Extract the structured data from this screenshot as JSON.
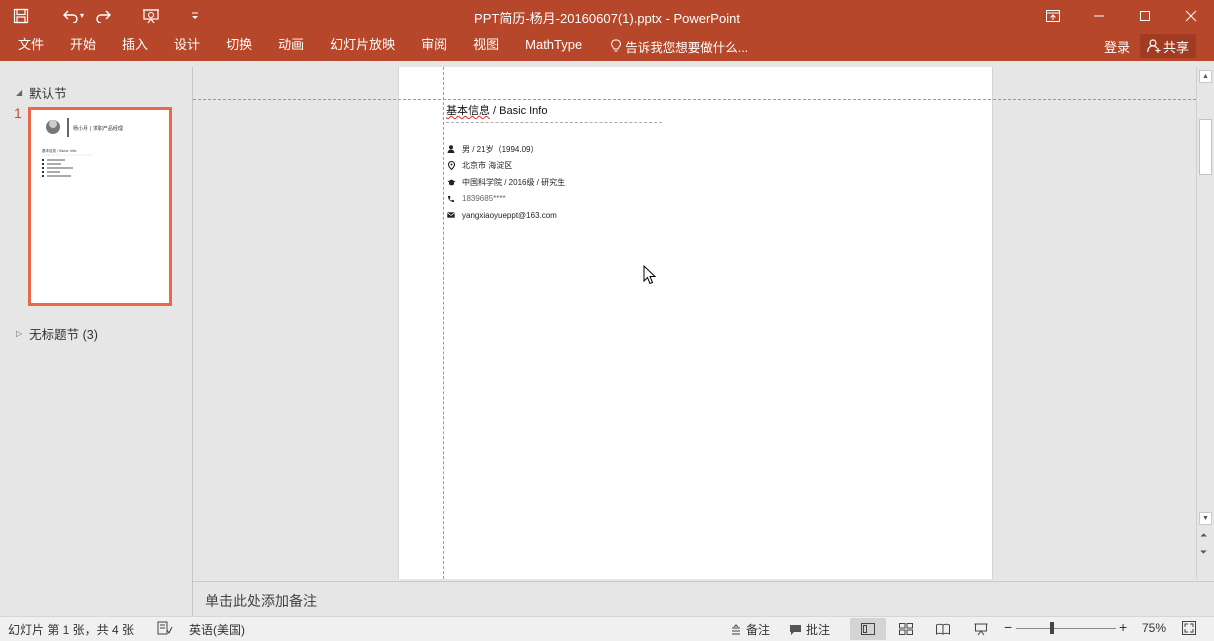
{
  "window": {
    "title": "PPT简历-杨月-20160607(1).pptx - PowerPoint"
  },
  "qat": {
    "icons": [
      "save-icon",
      "undo-icon",
      "redo-icon",
      "present-from-start-icon",
      "customize-qat-icon"
    ]
  },
  "ribbon": {
    "tabs": [
      "文件",
      "开始",
      "插入",
      "设计",
      "切换",
      "动画",
      "幻灯片放映",
      "审阅",
      "视图",
      "MathType"
    ],
    "tell_me": "告诉我您想要做什么...",
    "login": "登录",
    "share": "共享"
  },
  "thumbnails": {
    "section_default": "默认节",
    "section_untitled": "无标题节 (3)",
    "slide_number": "1",
    "thumb_title": "杨小月 | 求职产品经理",
    "thumb_subtitle": "基本信息 / Basic Info"
  },
  "slide": {
    "heading_cn": "基本信息",
    "heading_rest": " / Basic Info",
    "info": [
      {
        "icon": "person-icon",
        "text": "男 / 21岁（1994.09）"
      },
      {
        "icon": "location-pin-icon",
        "text": "北京市 海淀区"
      },
      {
        "icon": "graduation-cap-icon",
        "text": "中国科学院  / 2016级 / 研究生"
      },
      {
        "icon": "phone-icon",
        "text": "1839685****"
      },
      {
        "icon": "mail-icon",
        "text": "yangxiaoyueppt@163.com"
      }
    ]
  },
  "notes": {
    "placeholder": "单击此处添加备注"
  },
  "status": {
    "slide_info": "幻灯片 第 1 张，共 4 张",
    "language": "英语(美国)",
    "notes_label": "备注",
    "comments_label": "批注",
    "zoom": "75%"
  },
  "colors": {
    "brand": "#b7472a",
    "share_bg": "#a13c22",
    "thumb_border": "#e8694a",
    "slide_number": "#d24726"
  }
}
